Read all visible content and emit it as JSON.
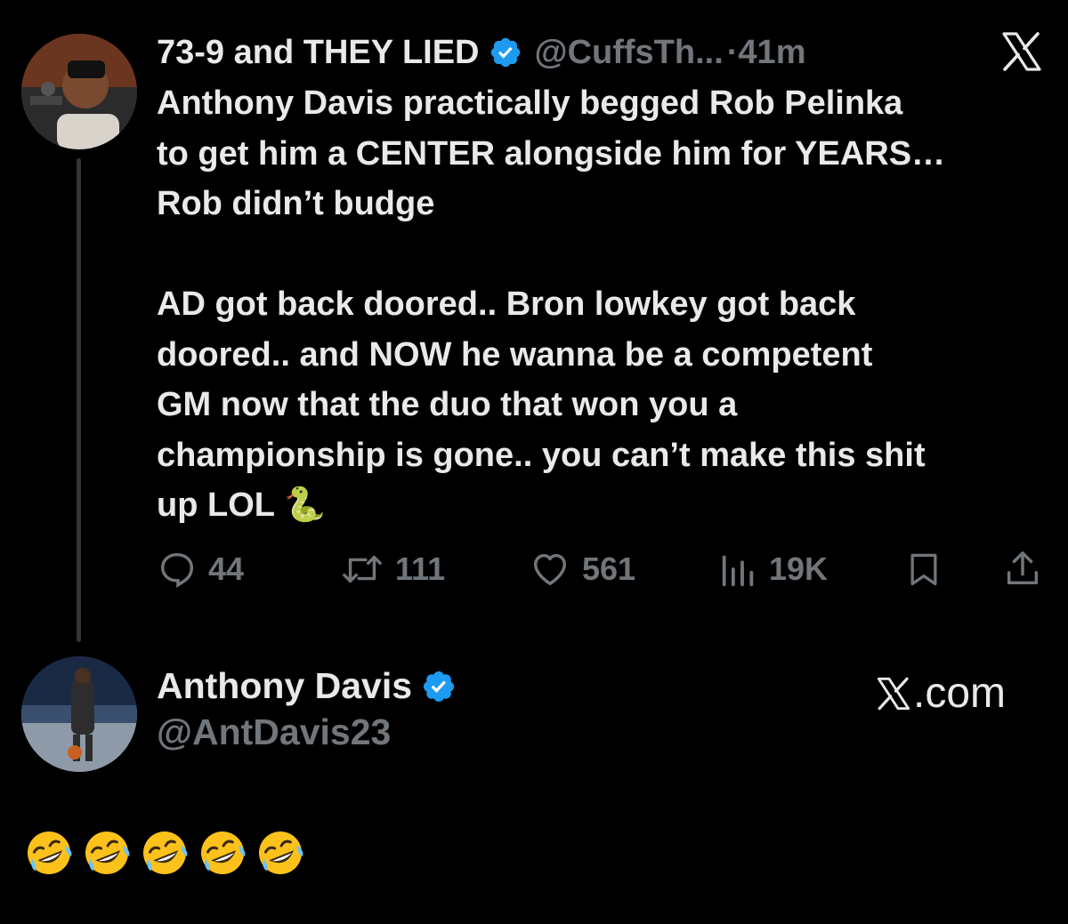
{
  "tweet1": {
    "display_name": "73-9 and THEY LIED",
    "handle": "@CuffsTh...",
    "separator": "·",
    "time": "41m",
    "text": "Anthony Davis practically begged Rob Pelinka\nto get him a CENTER alongside him for YEARS…\nRob didn’t budge\n\nAD got back doored.. Bron lowkey got back\ndoored.. and NOW he wanna be a competent\nGM now that the duo that won you a\nchampionship is gone.. you can’t make this shit\nup LOL 🐍",
    "actions": {
      "replies": "44",
      "reposts": "111",
      "likes": "561",
      "views": "19K"
    },
    "icons": {
      "avatar": "avatar-image",
      "verified": "verified-badge-icon",
      "close": "x-logo-icon",
      "reply": "reply-icon",
      "repost": "repost-icon",
      "like": "heart-icon",
      "views": "views-bar-chart-icon",
      "bookmark": "bookmark-icon",
      "share": "share-icon"
    }
  },
  "tweet2": {
    "display_name": "Anthony Davis",
    "handle": "@AntDavis23",
    "site": ".com",
    "reaction": "🤣🤣🤣🤣🤣"
  },
  "colors": {
    "background": "#000000",
    "text_primary": "#e7e9ea",
    "text_secondary": "#71767b",
    "verified_blue": "#1d9bf0"
  }
}
